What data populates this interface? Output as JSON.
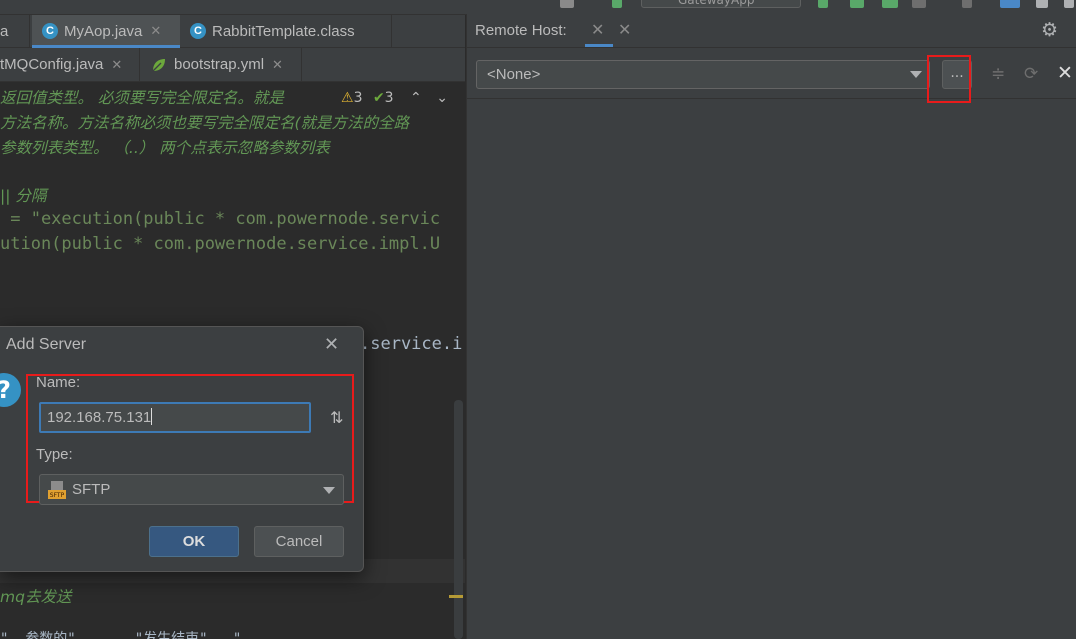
{
  "editor_tabs_row1": [
    {
      "label": "a",
      "icon": "none"
    },
    {
      "label": "MyAop.java",
      "icon": "class-c-icon",
      "active": true
    },
    {
      "label": "RabbitTemplate.class",
      "icon": "class-c-icon"
    }
  ],
  "editor_tabs_row2": [
    {
      "label": "tMQConfig.java"
    },
    {
      "label": "bootstrap.yml",
      "icon": "spring-leaf-icon"
    }
  ],
  "run_config": "GatewayApp",
  "inspections": {
    "warnings": "3",
    "weak_warnings": "3"
  },
  "code_lines": [
    "返回值类型。 必须要写完全限定名。就是",
    "方法名称。方法名称必须也要写完全限定名(就是方法的全路",
    "参数列表类型。 （..） 两个点表示忽略参数列表",
    "",
    "|| 分隔",
    " = \"execution(public * com.powernode.servic",
    "ution(public * com.powernode.service.impl.U",
    ".service.i",
    "mq去发送",
    "\"  参数的\"       \"发生结束\"   \"     "
  ],
  "remote_host": {
    "title": "Remote Host:",
    "selected": "<None>",
    "browse_label": "..."
  },
  "dialog": {
    "title": "Add Server",
    "name_label": "Name:",
    "name_value": "192.168.75.131",
    "type_label": "Type:",
    "type_value": "SFTP",
    "ok_label": "OK",
    "cancel_label": "Cancel"
  },
  "colors": {
    "highlight_red": "#e81b1b",
    "accent_blue": "#4a88c7",
    "comment_green": "#629755"
  }
}
